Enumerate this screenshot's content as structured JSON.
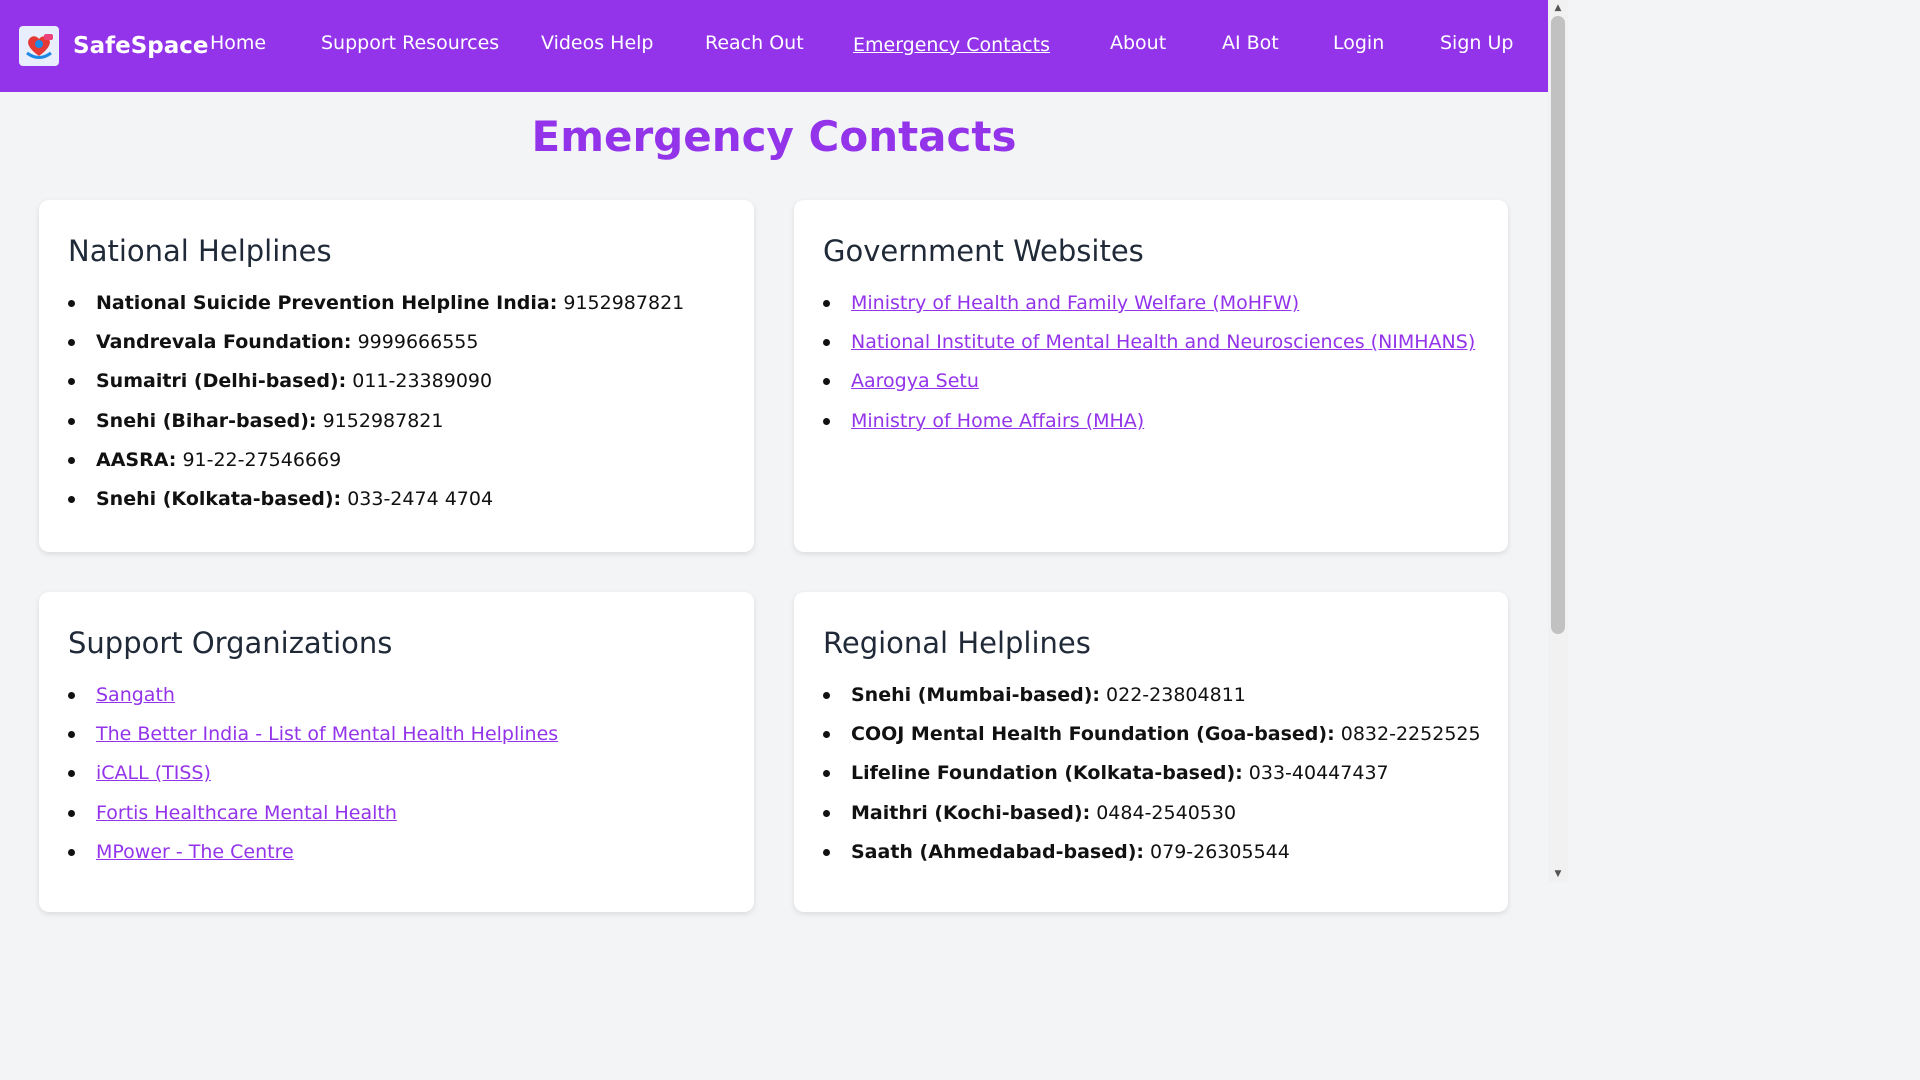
{
  "brand": {
    "name": "SafeSpace",
    "logo_icon": "heart-hands-icon"
  },
  "nav": {
    "items": [
      {
        "label": "Home",
        "active": false
      },
      {
        "label": "Support Resources",
        "active": false
      },
      {
        "label": "Videos Help",
        "active": false
      },
      {
        "label": "Reach Out",
        "active": false
      },
      {
        "label": "Emergency Contacts",
        "active": true
      },
      {
        "label": "About",
        "active": false
      },
      {
        "label": "AI Bot",
        "active": false
      },
      {
        "label": "Login",
        "active": false
      },
      {
        "label": "Sign Up",
        "active": false
      }
    ]
  },
  "page": {
    "title": "Emergency Contacts"
  },
  "national": {
    "heading": "National Helplines",
    "items": [
      {
        "name": "National Suicide Prevention Helpline India:",
        "number": "9152987821"
      },
      {
        "name": "Vandrevala Foundation:",
        "number": "9999666555"
      },
      {
        "name": "Sumaitri (Delhi-based):",
        "number": "011-23389090"
      },
      {
        "name": "Snehi (Bihar-based):",
        "number": "9152987821"
      },
      {
        "name": "AASRA:",
        "number": "91-22-27546669"
      },
      {
        "name": "Snehi (Kolkata-based):",
        "number": "033-2474 4704"
      }
    ]
  },
  "government": {
    "heading": "Government Websites",
    "links": [
      "Ministry of Health and Family Welfare (MoHFW)",
      "National Institute of Mental Health and Neurosciences (NIMHANS)",
      "Aarogya Setu",
      "Ministry of Home Affairs (MHA)"
    ]
  },
  "support": {
    "heading": "Support Organizations",
    "links": [
      "Sangath",
      "The Better India - List of Mental Health Helplines",
      "iCALL (TISS)",
      "Fortis Healthcare Mental Health",
      "MPower - The Centre"
    ]
  },
  "regional": {
    "heading": "Regional Helplines",
    "items": [
      {
        "name": "Snehi (Mumbai-based):",
        "number": "022-23804811"
      },
      {
        "name": "COOJ Mental Health Foundation (Goa-based):",
        "number": "0832-2252525"
      },
      {
        "name": "Lifeline Foundation (Kolkata-based):",
        "number": "033-40447437"
      },
      {
        "name": "Maithri (Kochi-based):",
        "number": "0484-2540530"
      },
      {
        "name": "Saath (Ahmedabad-based):",
        "number": "079-26305544"
      }
    ]
  },
  "colors": {
    "accent": "#9333ea",
    "background": "#f3f4f6",
    "card": "#ffffff"
  }
}
